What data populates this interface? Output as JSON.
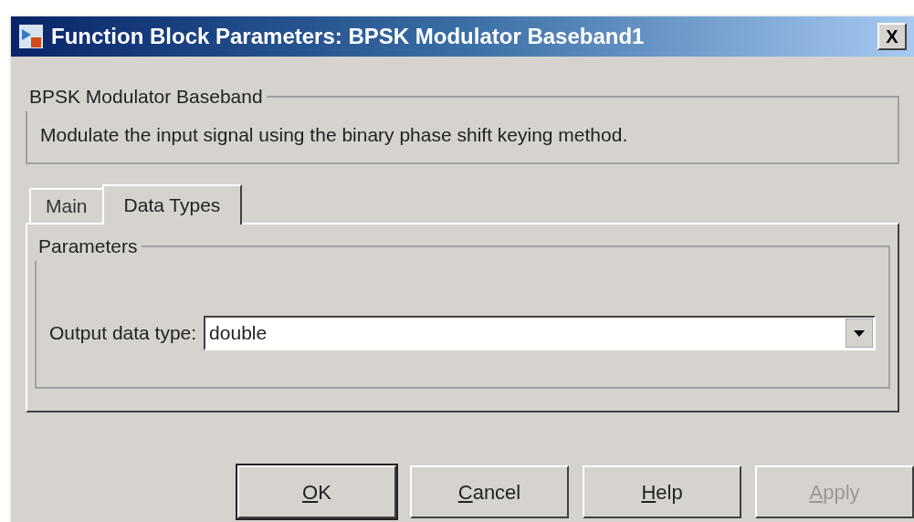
{
  "window": {
    "title": "Function Block Parameters: BPSK Modulator Baseband1",
    "close": "X"
  },
  "description_group": {
    "title": "BPSK Modulator Baseband",
    "text": "Modulate the input signal using the binary phase shift keying method."
  },
  "tabs": [
    {
      "label": "Main",
      "selected": false
    },
    {
      "label": "Data Types",
      "selected": true
    }
  ],
  "parameters_group": {
    "title": "Parameters",
    "fields": [
      {
        "label": "Output data type:",
        "value": "double"
      }
    ]
  },
  "buttons": [
    {
      "label": "OK",
      "disabled": false,
      "default": true
    },
    {
      "label": "Cancel",
      "disabled": false,
      "default": false
    },
    {
      "label": "Help",
      "disabled": false,
      "default": false
    },
    {
      "label": "Apply",
      "disabled": true,
      "default": false
    }
  ]
}
